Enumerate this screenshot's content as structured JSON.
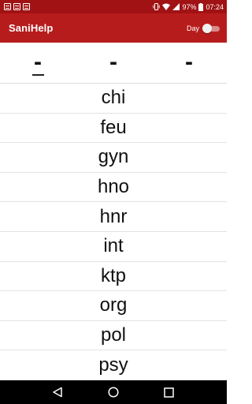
{
  "status_bar": {
    "battery": "97%",
    "time": "07:24",
    "icons": [
      "notification-icon",
      "notification-icon",
      "notification-icon",
      "vibrate-icon",
      "wifi-icon",
      "signal-icon",
      "battery-icon"
    ]
  },
  "app_bar": {
    "title": "SaniHelp",
    "toggle_label": "Day",
    "toggle_on": false
  },
  "tabs": [
    {
      "label": "-",
      "selected": true
    },
    {
      "label": "-",
      "selected": false
    },
    {
      "label": "-",
      "selected": false
    }
  ],
  "list": {
    "items": [
      "chi",
      "feu",
      "gyn",
      "hno",
      "hnr",
      "int",
      "ktp",
      "org",
      "pol",
      "psy"
    ]
  },
  "nav_bar": {
    "icons": [
      "back-icon",
      "home-icon",
      "recents-icon"
    ]
  },
  "colors": {
    "status_bar": "#a01214",
    "app_bar": "#b71c1c"
  }
}
